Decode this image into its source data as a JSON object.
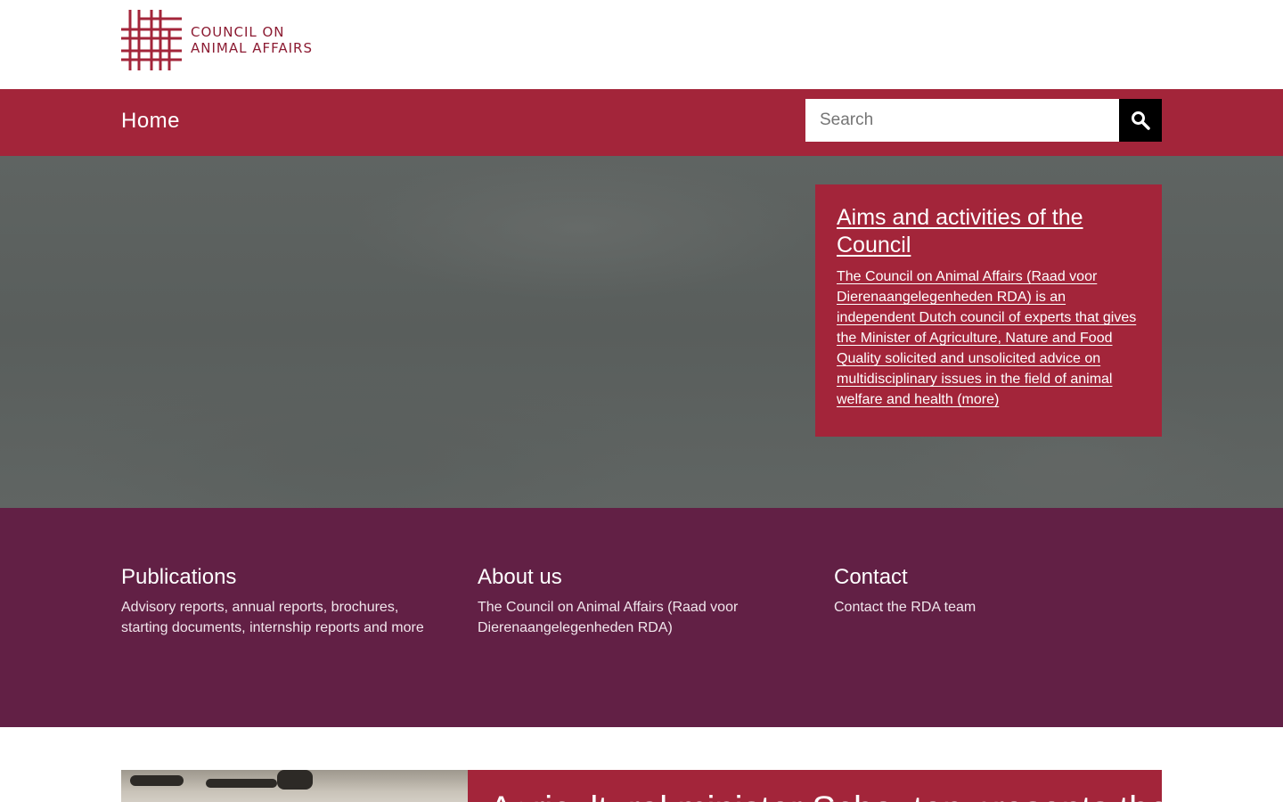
{
  "header": {
    "logo_line1": "COUNCIL ON",
    "logo_line2": "ANIMAL AFFAIRS"
  },
  "nav": {
    "home": "Home",
    "search_placeholder": "Search"
  },
  "hero": {
    "title": "Aims and activities of the Council",
    "text": "The Council on Animal Affairs (Raad voor Dierenaangelegenheden RDA) is an independent Dutch council of experts that gives the Minister of Agriculture, Nature and Food Quality solicited and unsolicited advice on multidisciplinary issues in the field of animal welfare and health (more)"
  },
  "links": [
    {
      "title": "Publications",
      "text": "Advisory reports, annual reports, brochures, starting documents, internship reports and more"
    },
    {
      "title": "About us",
      "text": "The Council on Animal Affairs (Raad voor Dierenaangelegenheden RDA)"
    },
    {
      "title": "Contact",
      "text": "Contact the RDA team"
    }
  ],
  "bottom": {
    "card_title": "Agricultural minister Schouten presents the Council"
  },
  "colors": {
    "brand_red": "#a3253a",
    "brand_purple": "#622045",
    "logo_red": "#8c1b32"
  },
  "icons": {
    "search": "search-icon",
    "logo": "grid-logo-icon"
  }
}
